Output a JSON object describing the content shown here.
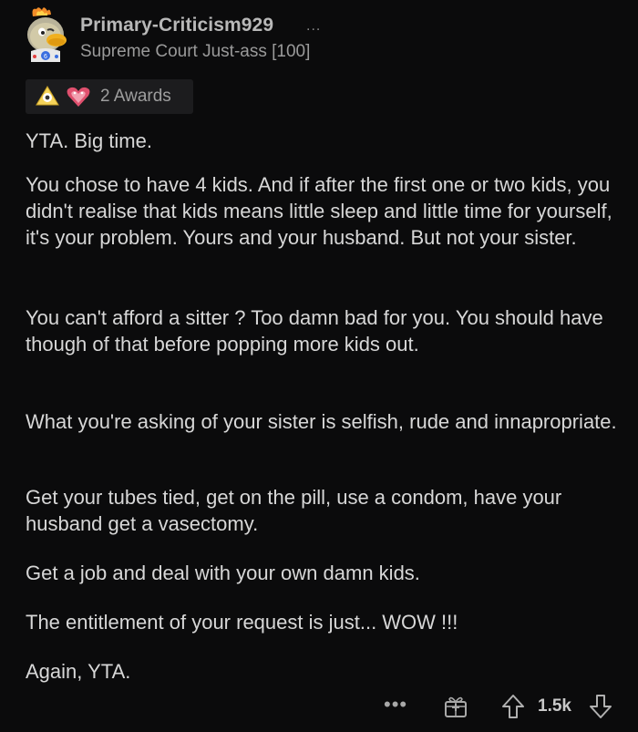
{
  "comment": {
    "author": {
      "username": "Primary-Criticism929",
      "flair": "Supreme Court Just-ass [100]",
      "avatar_icon": "duck-avatar-icon"
    },
    "more_indicator": "...",
    "awards": {
      "count_label": "2 Awards",
      "icons": [
        "bananadine-award-icon",
        "heart-eyes-award-icon"
      ]
    },
    "paragraphs": [
      "YTA. Big time.",
      "You chose to have 4 kids. And if after the first one or two kids, you didn't realise that kids means little sleep and little time for yourself, it's your problem. Yours and your husband. But not your sister.",
      "You can't afford a sitter ? Too damn bad for you. You should have though of that before popping more kids out.",
      "What you're asking of your sister is selfish, rude and innapropriate.",
      "Get your tubes tied, get on the pill, use a condom, have your husband get a vasectomy.",
      "Get a job and deal with your own damn kids.",
      "The entitlement of your request is just... WOW !!!",
      "Again, YTA."
    ],
    "footer": {
      "more_label": "•••",
      "score": "1.5k"
    }
  },
  "colors": {
    "background": "#0b0b0c",
    "text": "#d7d7d7",
    "muted": "#9a9a9a"
  }
}
